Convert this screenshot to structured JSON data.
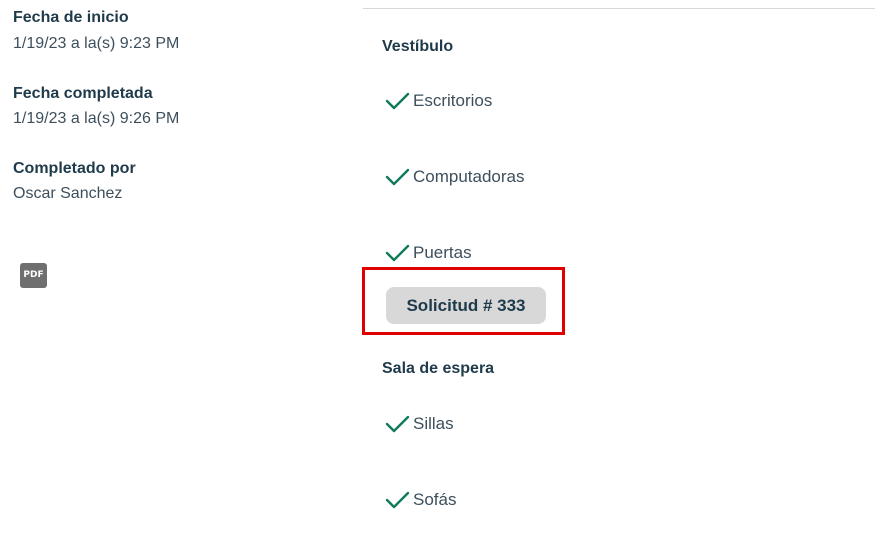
{
  "details": {
    "start_label": "Fecha de inicio",
    "start_value": "1/19/23 a la(s) 9:23 PM",
    "completed_label": "Fecha completada",
    "completed_value": "1/19/23 a la(s) 9:26 PM",
    "completed_by_label": "Completado por",
    "completed_by_value": "Oscar Sanchez",
    "pdf_icon": "pdf-icon",
    "pdf_text": "PDF"
  },
  "checklist": {
    "sections": [
      {
        "title": "Vestíbulo",
        "items": [
          {
            "label": "Escritorios",
            "icon": "check-icon"
          },
          {
            "label": "Computadoras",
            "icon": "check-icon"
          },
          {
            "label": "Puertas",
            "icon": "check-icon"
          }
        ],
        "request_button": "Solicitud # 333"
      },
      {
        "title": "Sala de espera",
        "items": [
          {
            "label": "Sillas",
            "icon": "check-icon"
          },
          {
            "label": "Sofás",
            "icon": "check-icon"
          }
        ]
      }
    ]
  },
  "colors": {
    "check": "#0f7a5a",
    "highlight": "#e10000",
    "button_bg": "#d8d8d8",
    "text_dark": "#1f3a4a"
  }
}
